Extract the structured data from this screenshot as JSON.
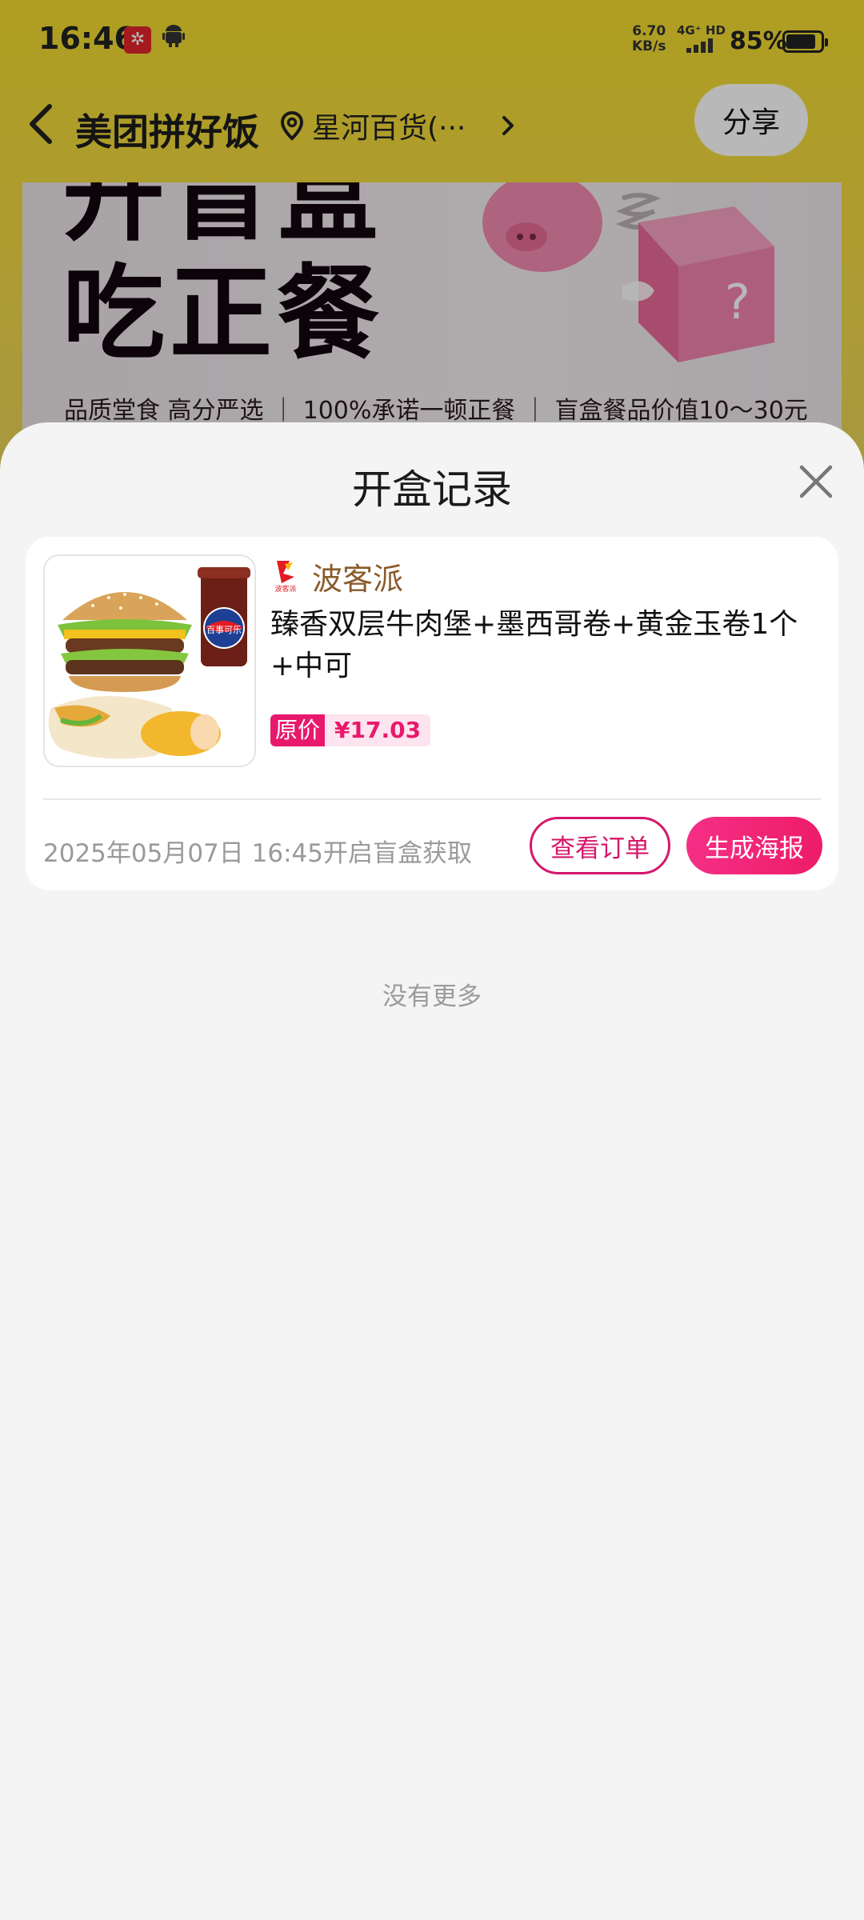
{
  "status_bar": {
    "time": "16:46",
    "app_icon_1": "metro-icon",
    "app_icon_2": "android-icon",
    "net_speed_value": "6.70",
    "net_speed_unit": "KB/s",
    "network": "4G⁺ HD",
    "battery": "85%"
  },
  "nav": {
    "title": "美团拼好饭",
    "location": "星河百货(···",
    "share_label": "分享"
  },
  "banner": {
    "line1": "开盲盒",
    "line2": "吃正餐",
    "tagline": "品质堂食 高分严选 ｜ 100%承诺一顿正餐 ｜ 盲盒餐品价值10～30元"
  },
  "sheet": {
    "title": "开盒记录",
    "close_icon": "close-icon",
    "records": [
      {
        "brand": "波客派",
        "brand_logo_text": "波客派",
        "product": "臻香双层牛肉堡+墨西哥卷+黄金玉卷1个+中可",
        "price_label": "原价",
        "price": "¥17.03",
        "cola_label": "百事可乐",
        "open_time": "2025年05月07日 16:45开启盲盒获取",
        "view_order_label": "查看订单",
        "poster_label": "生成海报"
      }
    ],
    "no_more": "没有更多"
  },
  "colors": {
    "accent": "#e8196c",
    "brand_text": "#8a5b2a",
    "header_bg": "#f3dc2e"
  }
}
